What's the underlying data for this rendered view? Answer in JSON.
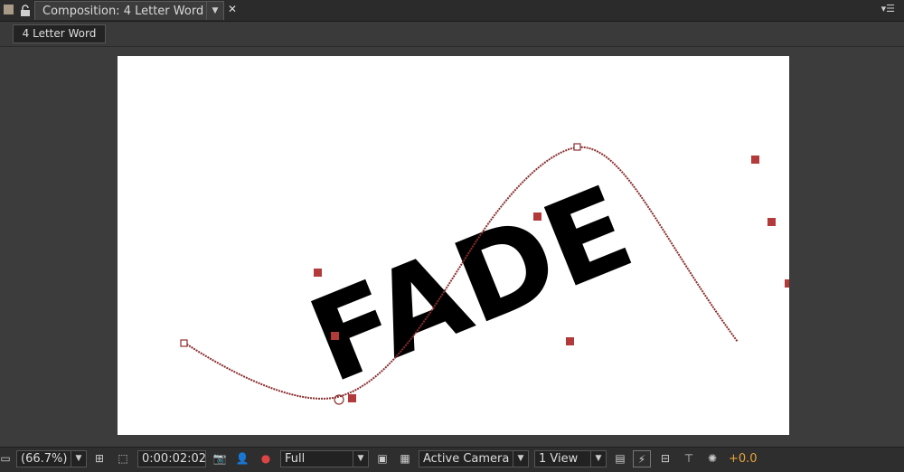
{
  "tab": {
    "title": "Composition: 4 Letter Word",
    "dropdown_glyph": "▼",
    "close_glyph": "✕",
    "menu_glyph": "▾☰"
  },
  "subbar": {
    "comp_name": "4 Letter Word"
  },
  "canvas": {
    "text": "FADE",
    "text_color": "#000000",
    "path_color": "#8b2e2e",
    "handle_color": "#b33a3a"
  },
  "toolbar": {
    "zoom": "(66.7%)",
    "timecode": "0:00:02:02",
    "resolution": "Full",
    "camera": "Active Camera",
    "views": "1 View",
    "exposure": "+0.0",
    "dropdown_glyph": "▼"
  },
  "colors": {
    "exposure": "#e8a33a",
    "panel": "#3a3a3a"
  }
}
